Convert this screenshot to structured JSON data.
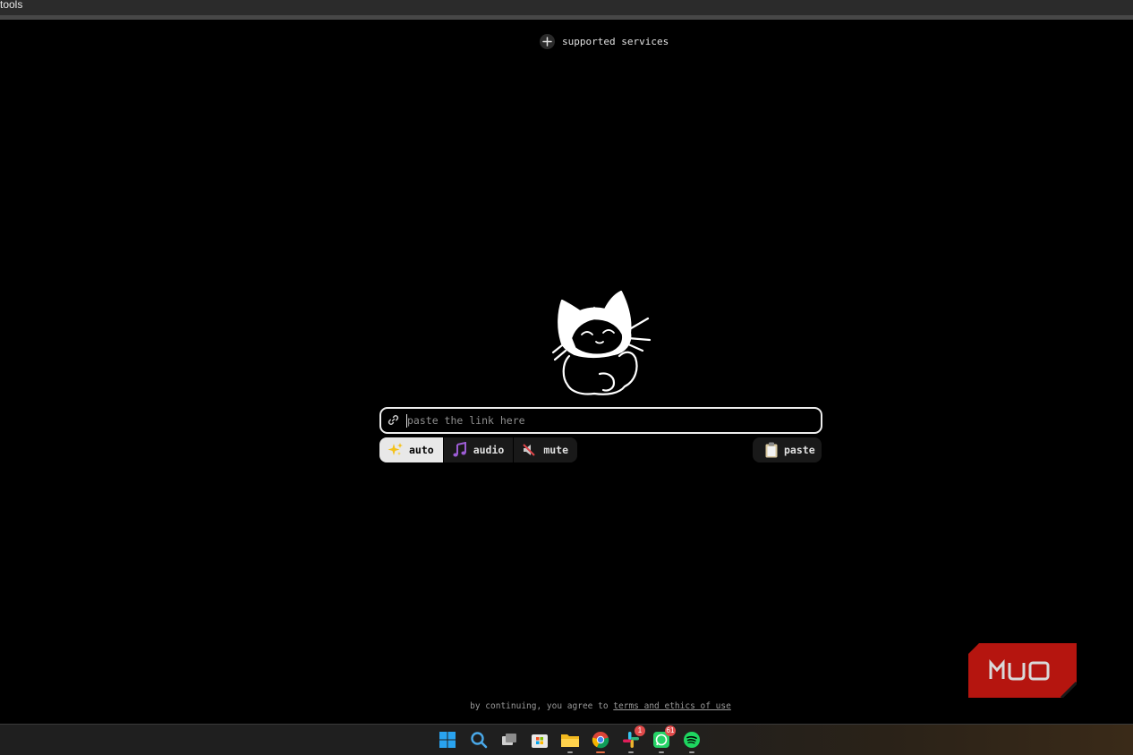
{
  "window": {
    "title": "tools"
  },
  "header": {
    "supported_services_label": "supported services"
  },
  "input": {
    "placeholder": "paste the link here"
  },
  "modes": [
    {
      "label": "auto",
      "icon": "sparkles-icon",
      "active": true
    },
    {
      "label": "audio",
      "icon": "music-note-icon",
      "active": false
    },
    {
      "label": "mute",
      "icon": "muted-speaker-icon",
      "active": false
    }
  ],
  "paste_button": {
    "label": "paste",
    "icon": "clipboard-icon"
  },
  "footer": {
    "prefix": "by continuing, you agree to",
    "link": "terms and ethics of use"
  },
  "watermark": {
    "text": "MUO",
    "color": "#b5150f"
  },
  "taskbar": {
    "icons": [
      "windows-start-icon",
      "search-icon",
      "task-view-icon",
      "microsoft-store-icon",
      "file-explorer-icon",
      "chrome-icon",
      "slack-icon",
      "whatsapp-icon",
      "spotify-icon"
    ],
    "slack_badge": "1",
    "whatsapp_badge": "61"
  }
}
